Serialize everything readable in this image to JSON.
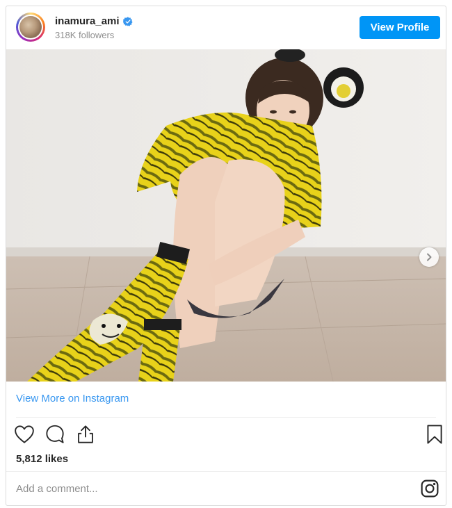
{
  "header": {
    "username": "inamura_ami",
    "followers": "318K followers",
    "view_profile_label": "View Profile",
    "verified_icon": "verified-badge-icon"
  },
  "photo": {
    "description_icon": "photo",
    "carousel_total": 3,
    "carousel_active": 1
  },
  "footer": {
    "view_more_label": "View More on Instagram",
    "likes": "5,812 likes",
    "comment_placeholder": "Add a comment...",
    "icons": [
      "heart-icon",
      "comment-icon",
      "share-icon",
      "bookmark-icon",
      "instagram-logo-icon"
    ]
  },
  "colors": {
    "accent": "#0095f6",
    "link": "#3897f0",
    "text": "#262626",
    "muted": "#8e8e8e",
    "border": "#dbdbdb"
  }
}
